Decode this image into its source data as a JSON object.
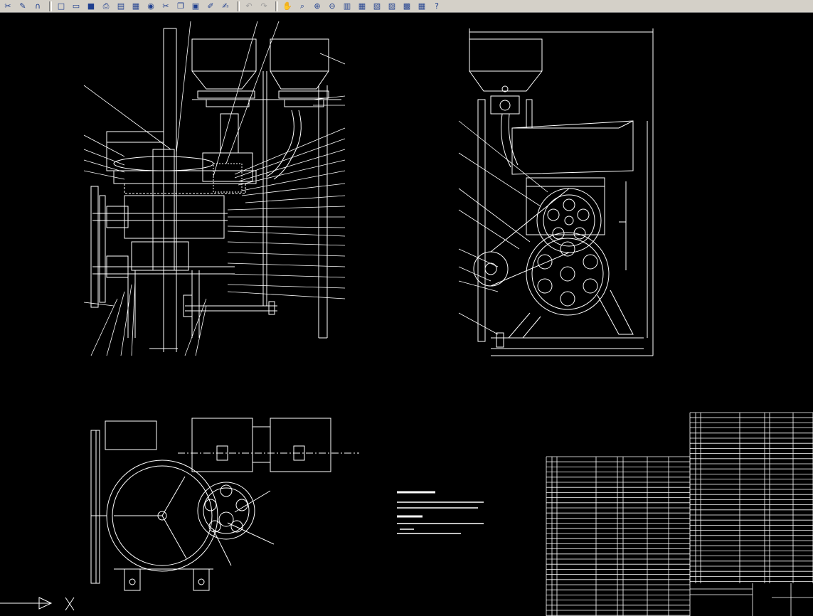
{
  "toolbar": {
    "groups": [
      [
        "trim-icon",
        "edit-icon",
        "magnet-icon"
      ],
      [
        "new-file-icon",
        "open-file-icon",
        "save-icon",
        "print-icon",
        "preview-icon",
        "publish-icon",
        "web-icon",
        "cut-icon",
        "copy-icon",
        "paste-icon",
        "brush-icon",
        "match-prop-icon"
      ],
      [
        "undo-icon",
        "redo-icon"
      ],
      [
        "pan-icon",
        "zoom-realtime-icon",
        "zoom-window-icon",
        "zoom-previous-icon",
        "properties-icon",
        "design-center-icon",
        "tool-palette-icon",
        "sheet-set-icon",
        "markup-icon",
        "calculator-icon",
        "help-icon"
      ]
    ],
    "glyphs": {
      "trim-icon": "✂",
      "edit-icon": "✎",
      "magnet-icon": "∩",
      "new-file-icon": "□",
      "open-file-icon": "▭",
      "save-icon": "■",
      "print-icon": "⎙",
      "preview-icon": "▤",
      "publish-icon": "▦",
      "web-icon": "◉",
      "cut-icon": "✂",
      "copy-icon": "❐",
      "paste-icon": "▣",
      "brush-icon": "✐",
      "match-prop-icon": "✍",
      "undo-icon": "↶",
      "redo-icon": "↷",
      "pan-icon": "✋",
      "zoom-realtime-icon": "⌕",
      "zoom-window-icon": "⊕",
      "zoom-previous-icon": "⊖",
      "properties-icon": "▥",
      "design-center-icon": "▦",
      "tool-palette-icon": "▧",
      "sheet-set-icon": "▨",
      "markup-icon": "▩",
      "calculator-icon": "▦",
      "help-icon": "?"
    }
  },
  "drawing": {
    "line_color": "#ffffff",
    "background": "#000000"
  }
}
